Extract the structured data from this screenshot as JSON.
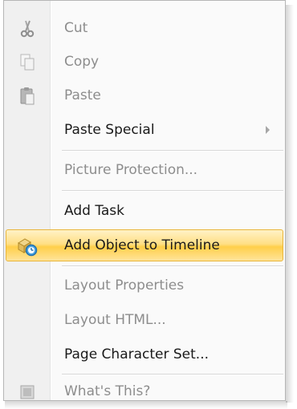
{
  "menu": {
    "items": [
      {
        "label": "Cut",
        "icon": "scissors-icon",
        "enabled": false
      },
      {
        "label": "Copy",
        "icon": "copy-icon",
        "enabled": false
      },
      {
        "label": "Paste",
        "icon": "clipboard-icon",
        "enabled": false
      },
      {
        "label": "Paste Special",
        "enabled": true,
        "submenu": true
      },
      {
        "label": "Picture Protection...",
        "enabled": false
      },
      {
        "label": "Add Task",
        "enabled": true
      },
      {
        "label": "Add Object to Timeline",
        "icon": "timeline-clock-icon",
        "enabled": true,
        "highlighted": true
      },
      {
        "label": "Layout Properties",
        "enabled": false
      },
      {
        "label": "Layout HTML...",
        "enabled": false
      },
      {
        "label": "Page Character Set...",
        "enabled": true
      },
      {
        "label": "What's This?",
        "icon": "whats-this-icon",
        "enabled": false
      }
    ]
  },
  "colors": {
    "highlight_top": "#fff2c6",
    "highlight_bottom": "#ffcf4a",
    "highlight_border": "#e9b53a",
    "enabled_text": "#1a1a1a",
    "disabled_text": "#8d8d8d",
    "gutter": "#f0f0f0"
  }
}
